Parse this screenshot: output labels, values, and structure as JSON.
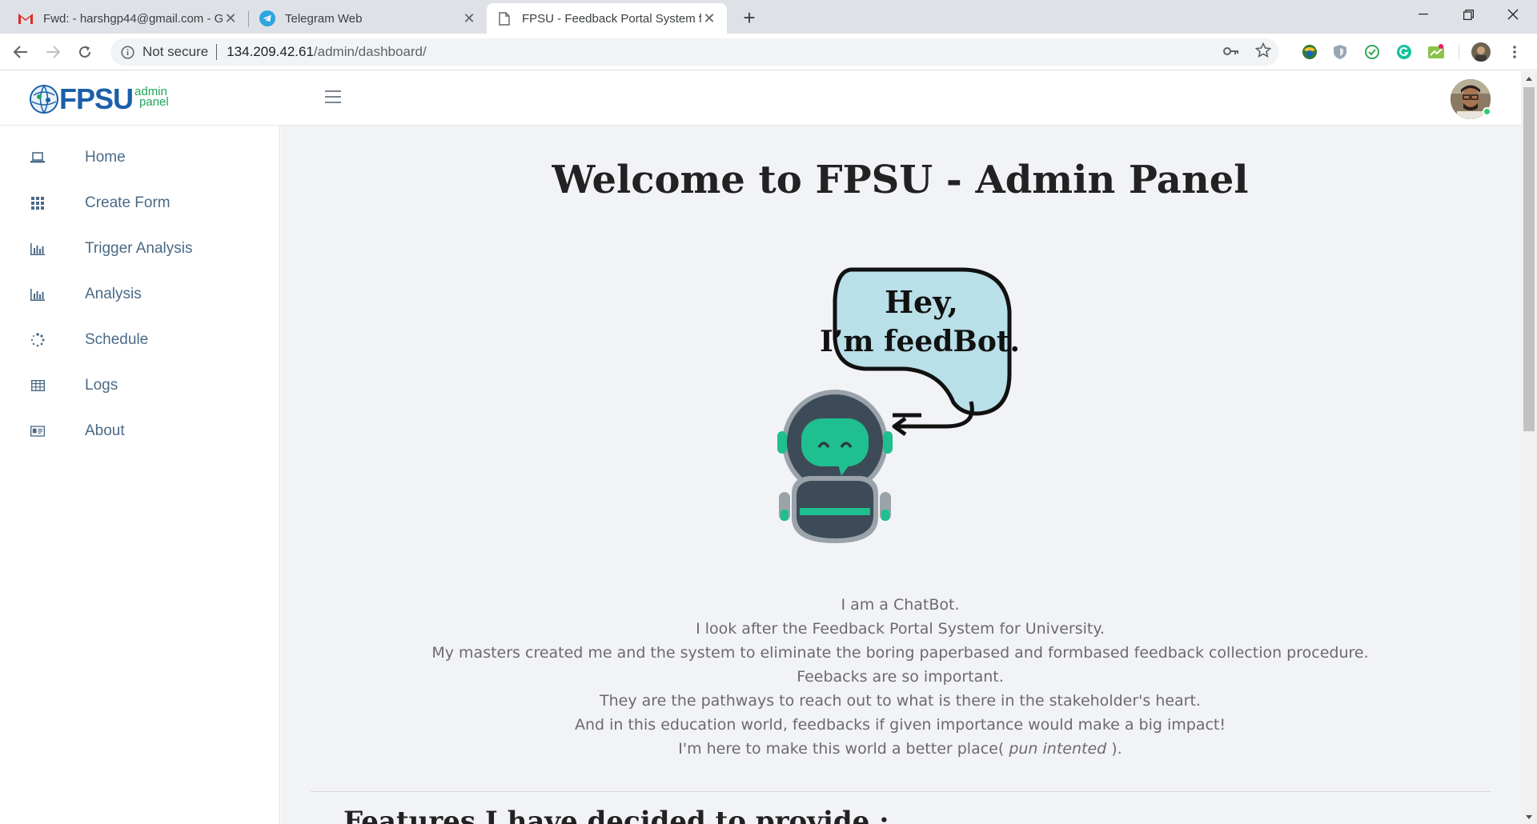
{
  "browser": {
    "tabs": [
      {
        "title": "Fwd: - harshgp44@gmail.com - G",
        "icon": "gmail-icon",
        "active": false
      },
      {
        "title": "Telegram Web",
        "icon": "telegram-icon",
        "active": false
      },
      {
        "title": "FPSU - Feedback Portal System fo",
        "icon": "page-icon",
        "active": true
      }
    ],
    "address": {
      "security_label": "Not secure",
      "host": "134.209.42.61",
      "path": "/admin/dashboard/"
    }
  },
  "header": {
    "logo_text": "FPSU",
    "logo_sub_top": "admin",
    "logo_sub_bottom": "panel"
  },
  "sidebar": {
    "items": [
      {
        "label": "Home",
        "icon": "laptop-icon"
      },
      {
        "label": "Create Form",
        "icon": "grid-icon"
      },
      {
        "label": "Trigger Analysis",
        "icon": "bar-chart-icon"
      },
      {
        "label": "Analysis",
        "icon": "bar-chart-icon"
      },
      {
        "label": "Schedule",
        "icon": "spinner-icon"
      },
      {
        "label": "Logs",
        "icon": "table-icon"
      },
      {
        "label": "About",
        "icon": "id-card-icon"
      }
    ]
  },
  "main": {
    "title": "Welcome to FPSU - Admin Panel",
    "bot_bubble_line1": "Hey,",
    "bot_bubble_line2": "I’m feedBot.",
    "intro": [
      "I am a ChatBot.",
      "I look after the Feedback Portal System for University.",
      "My masters created me and the system to eliminate the boring paperbased and formbased feedback collection procedure.",
      "Feebacks are so important.",
      "They are the pathways to reach out to what is there in the stakeholder's heart.",
      "And in this education world, feedbacks if given importance would make a big impact!"
    ],
    "last_line_prefix": "I'm here to make this world a better place(",
    "last_line_em": "pun intented",
    "last_line_suffix": ").",
    "features_heading": "Features I have decided to provide :"
  },
  "colors": {
    "accent_teal": "#1fbf8f",
    "sidebar_text": "#4a6a86",
    "main_bg": "#f2f3f7"
  }
}
